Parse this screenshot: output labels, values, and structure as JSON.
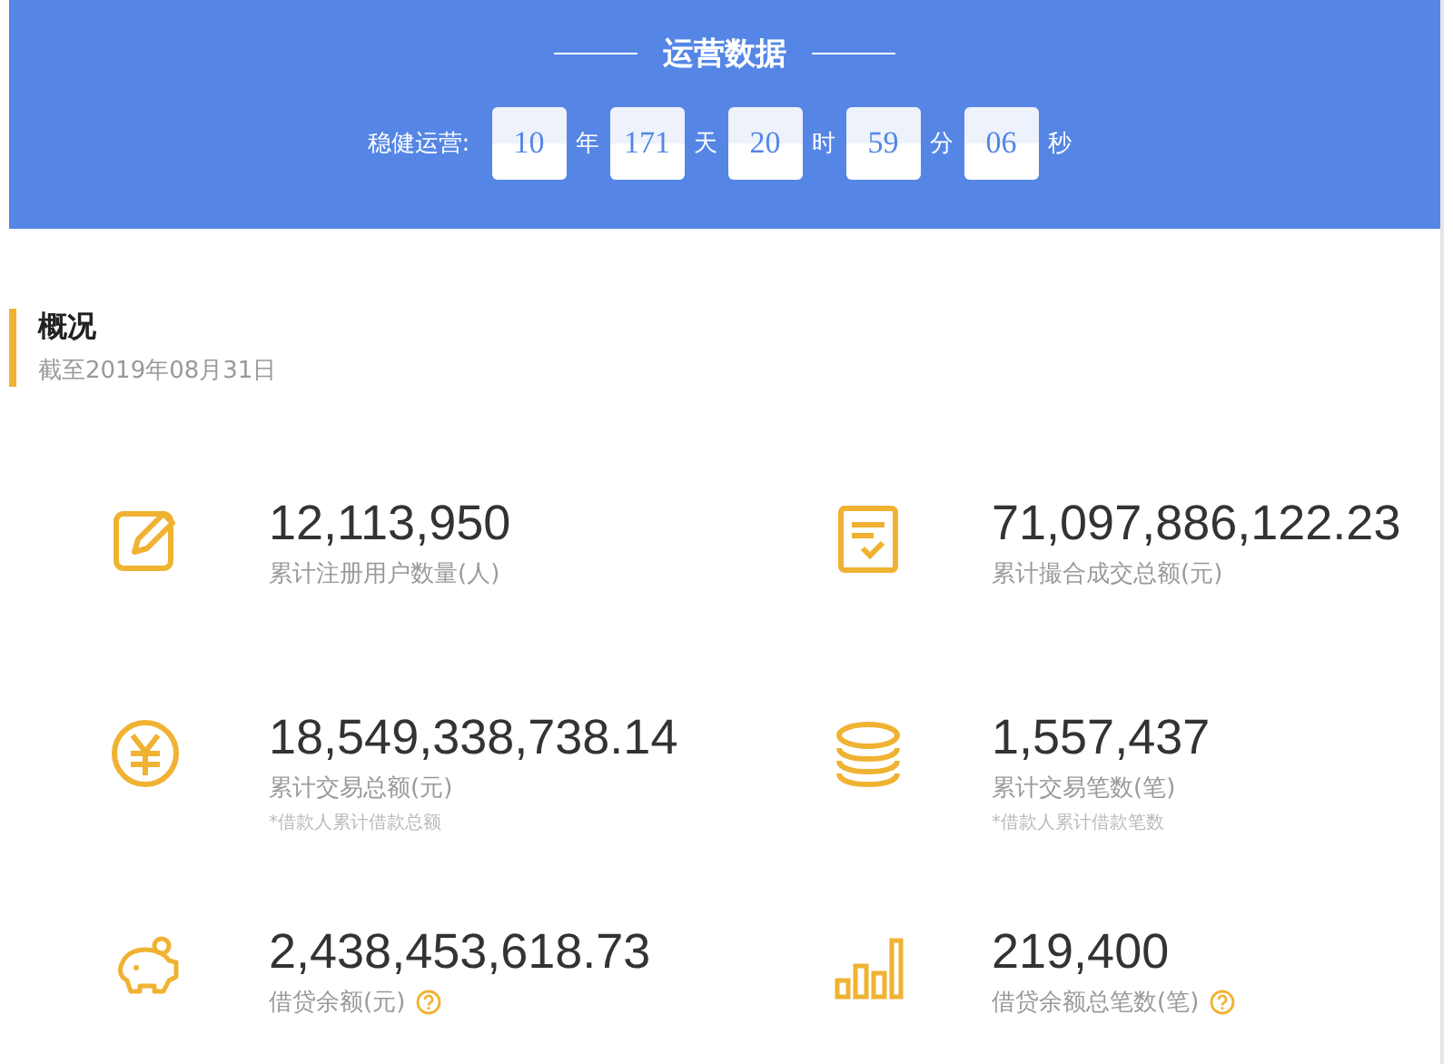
{
  "header": {
    "title": "运营数据",
    "uptime_label": "稳健运营:",
    "uptime": [
      {
        "value": "10",
        "unit": "年"
      },
      {
        "value": "171",
        "unit": "天"
      },
      {
        "value": "20",
        "unit": "时"
      },
      {
        "value": "59",
        "unit": "分"
      },
      {
        "value": "06",
        "unit": "秒"
      }
    ]
  },
  "overview": {
    "title": "概况",
    "subtitle": "截至2019年08月31日"
  },
  "stats": [
    {
      "value": "12,113,950",
      "label": "累计注册用户数量(人)",
      "help": false
    },
    {
      "value": "71,097,886,122.23",
      "label": "累计撮合成交总额(元)",
      "help": false
    },
    {
      "value": "18,549,338,738.14",
      "label": "累计交易总额(元)",
      "note": "*借款人累计借款总额",
      "help": false
    },
    {
      "value": "1,557,437",
      "label": "累计交易笔数(笔)",
      "note": "*借款人累计借款笔数",
      "help": false
    },
    {
      "value": "2,438,453,618.73",
      "label": "借贷余额(元)",
      "help": true
    },
    {
      "value": "219,400",
      "label": "借贷余额总笔数(笔)",
      "help": true
    }
  ]
}
